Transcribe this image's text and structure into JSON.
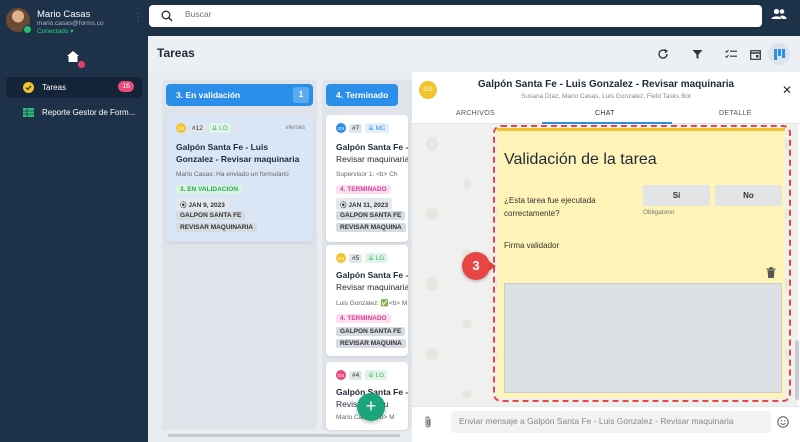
{
  "user": {
    "name": "Mario Casas",
    "email": "mario.casas@forms.co",
    "status": "Conectado"
  },
  "sidebar": {
    "items": [
      {
        "label": "Tareas",
        "count": "16"
      },
      {
        "label": "Reporte Gestor de Form..."
      }
    ]
  },
  "search": {
    "placeholder": "Buscar"
  },
  "header": {
    "title": "Tareas"
  },
  "columns": [
    {
      "title": "3. En validación",
      "count": "1"
    },
    {
      "title": "4. Terminado"
    }
  ],
  "cards": {
    "c12": {
      "avatar": "GS",
      "num": "#12",
      "tag": "LG",
      "day": "viernes",
      "title_l1": "Galpón Santa Fe - Luis",
      "title_l2": "Gonzalez - Revisar maquinaria",
      "sub": "Mario Casas: Ha enviado un formulario",
      "status": "3. EN VALIDACION",
      "date": "JAN 9, 2023",
      "place": "GALPON SANTA FE",
      "action": "REVISAR MAQUINARIA"
    },
    "c7": {
      "avatar": "GS",
      "num": "#7",
      "tag": "MC",
      "title_l1": "Galpón Santa Fe - I",
      "title_l2": "Revisar maquinaria",
      "sub": "Supervisor 1: <b> Ch",
      "status": "4. TERMINADO",
      "date": "JAN 11, 2023",
      "place": "GALPON SANTA FE",
      "action": "REVISAR MAQUINA"
    },
    "c5": {
      "avatar": "GS",
      "num": "#5",
      "tag": "LG",
      "title_l1": "Galpón Santa Fe - I",
      "title_l2": "Revisar maquinaria",
      "sub": "Luis Gonzalez: ✅<b> M",
      "status": "4. TERMINADO",
      "place": "GALPON SANTA FE",
      "action": "REVISAR MAQUINA"
    },
    "c4": {
      "avatar": "GS",
      "num": "#4",
      "tag": "LG",
      "title_l1": "Galpón Santa Fe - I",
      "title_l2": "Revisar maqu",
      "sub": "Mario Casas: <b> M"
    }
  },
  "panel": {
    "avatar": "GS",
    "title": "Galpón Santa Fe - Luis Gonzalez - Revisar maquinaria",
    "subtitle": "Susana Díaz, Mario Casas, Luis Gonzalez, Field Tasks Bot",
    "tabs": [
      "ARCHIVOS",
      "CHAT",
      "DETALLE"
    ],
    "active_tab": "CHAT"
  },
  "form": {
    "title": "Validación de la tarea",
    "question": "¿Esta tarea fue ejecutada correctamente?",
    "yes": "Sí",
    "no": "No",
    "required": "Obligatorio",
    "signature_label": "Firma validador"
  },
  "marker": "3",
  "compose": {
    "placeholder": "Enviar mensaje a Galpón Santa Fe - Luis Gonzalez - Revisar maquinaria"
  },
  "colors": {
    "sidebar": "#1d3149",
    "accent": "#2b8ee8",
    "fab": "#1aa57a",
    "form_bg": "#fff4b8",
    "marker": "#e84545"
  }
}
